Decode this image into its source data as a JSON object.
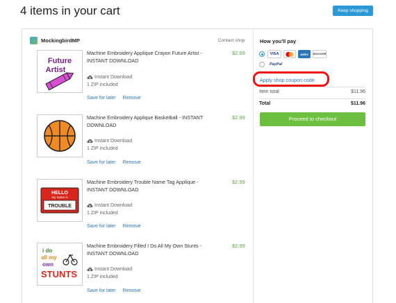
{
  "header": {
    "title": "4 items in your cart",
    "keep_shopping": "Keep shopping"
  },
  "shop": {
    "name": "MockingbirdMP",
    "contact": "Contact shop"
  },
  "items": [
    {
      "title": "Machine Embroidery Applique Crayon Future Artist - INSTANT DOWNLOAD",
      "download": "Instant Download",
      "files": "1 ZIP included",
      "save": "Save for later",
      "remove": "Remove",
      "price": "$2.99",
      "thumb_text": "Future Artist"
    },
    {
      "title": "Machine Embroidery Applique Basketball - INSTANT DOWNLOAD",
      "download": "Instant Download",
      "files": "1 ZIP included",
      "save": "Save for later",
      "remove": "Remove",
      "price": "$2.99"
    },
    {
      "title": "Machine Embroidery Trouble Name Tag Applique - INSTANT DOWNLOAD",
      "download": "Instant Download",
      "files": "1 ZIP included",
      "save": "Save for later",
      "remove": "Remove",
      "price": "$2.99",
      "thumb_text_top": "HELLO",
      "thumb_text_sub": "my name is",
      "thumb_text_main": "TROUBLE"
    },
    {
      "title": "Machine Embroidery Filled I Do All My Own Stunts - INSTANT DOWNLOAD",
      "download": "Instant Download",
      "files": "1 ZIP included",
      "save": "Save for later",
      "remove": "Remove",
      "price": "$2.99",
      "thumb_lines": [
        "i do",
        "all my",
        "own",
        "STUNTS"
      ]
    }
  ],
  "payment": {
    "title": "How you'll pay",
    "cards": [
      "VISA",
      "MC",
      "AMEX",
      "DISCOVER"
    ],
    "paypal": "PayPal",
    "coupon": "Apply shop coupon code"
  },
  "summary": {
    "item_total_label": "Item total",
    "item_total": "$11.96",
    "total_label": "Total",
    "total": "$11.96",
    "checkout": "Proceed to checkout"
  },
  "colors": {
    "accent_blue": "#2a99d6",
    "price_green": "#5ba843",
    "checkout_green": "#6cbf3f",
    "highlight_red": "#e11111"
  }
}
